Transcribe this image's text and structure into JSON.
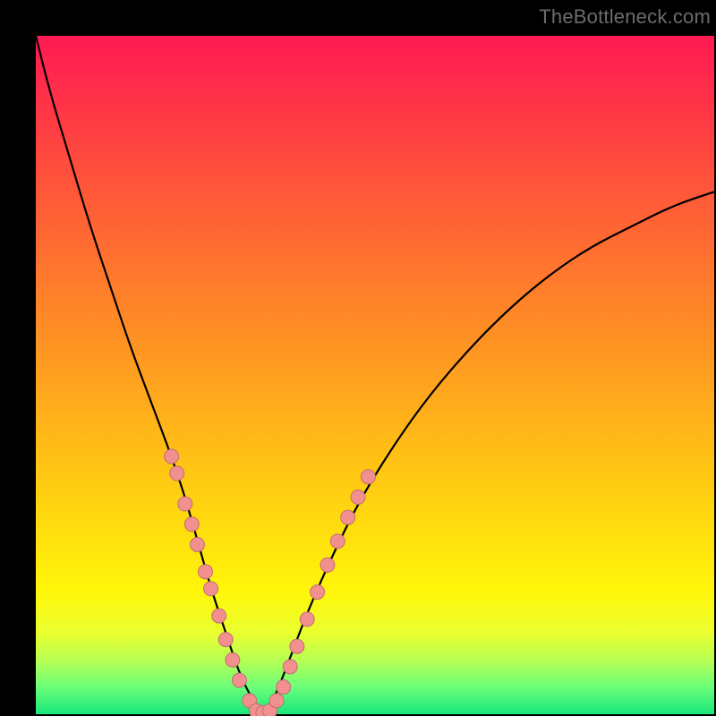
{
  "watermark": "TheBottleneck.com",
  "colors": {
    "frame": "#000000",
    "gradient_top": "#ff1a52",
    "gradient_mid": "#ffd60f",
    "gradient_bottom": "#18e67a",
    "curve": "#000000",
    "dot_fill": "#f28f8f",
    "dot_stroke": "#bf6f6f"
  },
  "chart_data": {
    "type": "line",
    "title": "",
    "xlabel": "",
    "ylabel": "",
    "xlim": [
      0,
      100
    ],
    "ylim": [
      0,
      100
    ],
    "grid": false,
    "legend": false,
    "series": [
      {
        "name": "bottleneck-curve",
        "x": [
          0,
          2,
          5,
          8,
          11,
          14,
          17,
          20,
          22,
          24,
          26,
          28,
          30,
          32,
          33.5,
          35,
          37,
          40,
          44,
          48,
          53,
          58,
          64,
          70,
          76,
          82,
          88,
          94,
          100
        ],
        "y": [
          100,
          92,
          82,
          72,
          63,
          54,
          46,
          38,
          32,
          25,
          18,
          12,
          6,
          2,
          0,
          2,
          7,
          15,
          24,
          32,
          40,
          47,
          54,
          60,
          65,
          69,
          72,
          75,
          77
        ]
      }
    ],
    "points": [
      {
        "name": "left-cluster",
        "xy": [
          [
            20.0,
            38.0
          ],
          [
            20.8,
            35.5
          ],
          [
            22.0,
            31.0
          ],
          [
            23.0,
            28.0
          ],
          [
            23.8,
            25.0
          ],
          [
            25.0,
            21.0
          ],
          [
            25.8,
            18.5
          ],
          [
            27.0,
            14.5
          ],
          [
            28.0,
            11.0
          ],
          [
            29.0,
            8.0
          ],
          [
            30.0,
            5.0
          ],
          [
            31.5,
            2.0
          ]
        ]
      },
      {
        "name": "bottom-cluster",
        "xy": [
          [
            32.5,
            0.5
          ],
          [
            33.5,
            0.2
          ],
          [
            34.5,
            0.5
          ]
        ]
      },
      {
        "name": "right-cluster",
        "xy": [
          [
            35.5,
            2.0
          ],
          [
            36.5,
            4.0
          ],
          [
            37.5,
            7.0
          ],
          [
            38.5,
            10.0
          ],
          [
            40.0,
            14.0
          ],
          [
            41.5,
            18.0
          ],
          [
            43.0,
            22.0
          ],
          [
            44.5,
            25.5
          ],
          [
            46.0,
            29.0
          ],
          [
            47.5,
            32.0
          ],
          [
            49.0,
            35.0
          ]
        ]
      }
    ]
  }
}
